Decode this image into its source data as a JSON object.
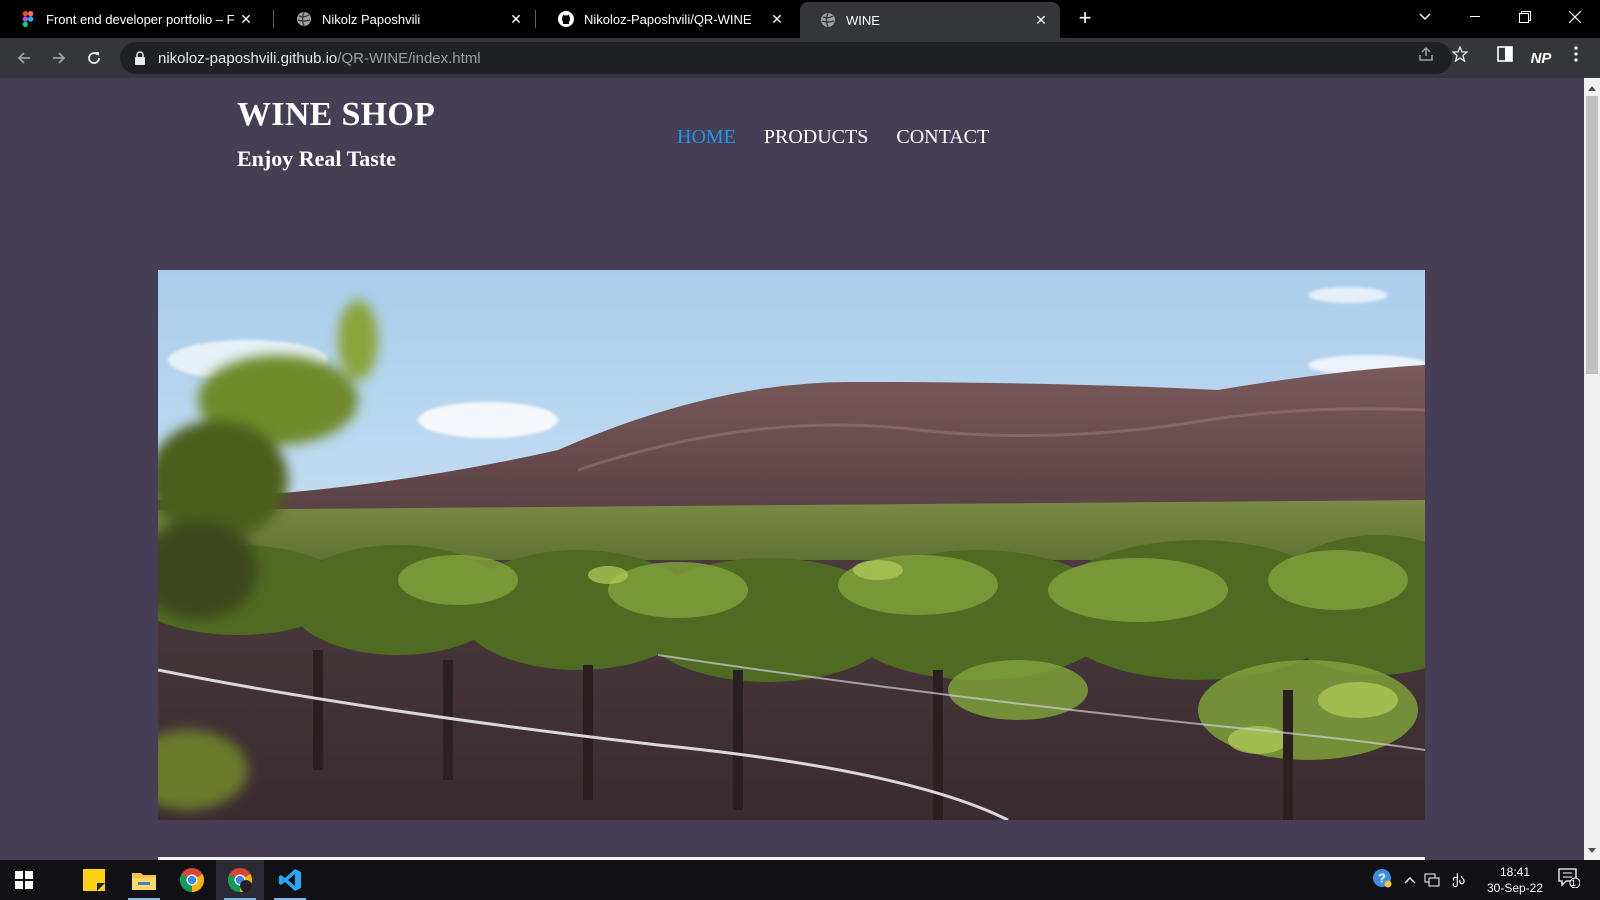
{
  "browser": {
    "tabs": [
      {
        "title": "Front end developer portfolio – F",
        "icon": "figma-icon"
      },
      {
        "title": "Nikolz Paposhvili",
        "icon": "globe-icon"
      },
      {
        "title": "Nikoloz-Paposhvili/QR-WINE",
        "icon": "github-icon"
      },
      {
        "title": "WINE",
        "icon": "globe-icon",
        "active": true
      }
    ],
    "new_tab": "+",
    "url_host": "nikoloz-paposhvili.github.io",
    "url_path": "/QR-WINE/index.html",
    "profile_initials": "NP"
  },
  "site": {
    "brand": "WINE SHOP",
    "tagline": "Enjoy Real Taste",
    "nav": [
      {
        "label": "HOME",
        "active": true
      },
      {
        "label": "PRODUCTS"
      },
      {
        "label": "CONTACT"
      }
    ],
    "hero_alt": "vineyard-landscape"
  },
  "taskbar": {
    "time": "18:41",
    "date": "30-Sep-22",
    "language": "ქა",
    "notification_count": "1"
  },
  "colors": {
    "page_bg": "#463e55",
    "nav_active": "#2196e8",
    "toolbar": "#35363a"
  }
}
